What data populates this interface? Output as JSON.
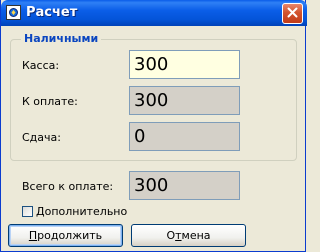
{
  "window": {
    "title": "Расчет",
    "icon": "app-icon",
    "close_icon": "close-icon"
  },
  "group": {
    "title": "Наличными",
    "kassa": {
      "label": "Касса:",
      "value": "300"
    },
    "k_oplate": {
      "label": "К оплате:",
      "value": "300"
    },
    "sdacha": {
      "label": "Сдача:",
      "value": "0"
    }
  },
  "total": {
    "label": "Всего к оплате:",
    "value": "300"
  },
  "extra": {
    "label": "Дополнительно",
    "checked": false
  },
  "buttons": {
    "continue": {
      "mnemonic": "П",
      "rest": "родолжить"
    },
    "cancel": {
      "pre": "О",
      "mnemonic": "т",
      "rest": "мена"
    }
  },
  "colors": {
    "titlebar": "#0454d8",
    "group_title": "#0b46c0",
    "active_field": "#ffffe1",
    "readonly_field": "#d4d0c8",
    "dialog_bg": "#ece9d8"
  }
}
